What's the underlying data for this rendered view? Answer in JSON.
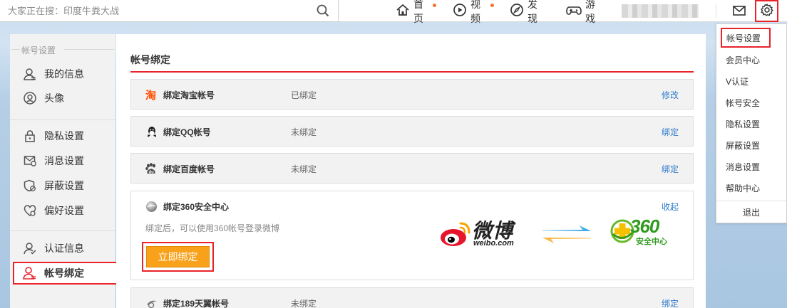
{
  "search": {
    "placeholder": "大家正在搜：印度牛粪大战"
  },
  "nav": {
    "home": "首页",
    "video": "视频",
    "discover": "发现",
    "game": "游戏"
  },
  "sidebar": {
    "heading": "帐号设置",
    "items": [
      {
        "label": "我的信息",
        "icon": "user-icon"
      },
      {
        "label": "头像",
        "icon": "avatar-icon"
      },
      {
        "label": "隐私设置",
        "icon": "lock-icon"
      },
      {
        "label": "消息设置",
        "icon": "message-icon"
      },
      {
        "label": "屏蔽设置",
        "icon": "shield-icon"
      },
      {
        "label": "偏好设置",
        "icon": "heart-icon"
      },
      {
        "label": "认证信息",
        "icon": "verify-icon"
      },
      {
        "label": "帐号绑定",
        "icon": "account-bind-icon"
      }
    ]
  },
  "main": {
    "title": "帐号绑定",
    "rows": [
      {
        "name": "绑定淘宝帐号",
        "status": "已绑定",
        "action": "修改",
        "icon": "taobao-icon"
      },
      {
        "name": "绑定QQ帐号",
        "status": "未绑定",
        "action": "绑定",
        "icon": "qq-icon"
      },
      {
        "name": "绑定百度帐号",
        "status": "未绑定",
        "action": "绑定",
        "icon": "baidu-icon"
      }
    ],
    "expanded": {
      "name": "绑定360安全中心",
      "action": "收起",
      "description": "绑定后，可以使用360帐号登录微博",
      "button": "立即绑定",
      "weibo_text": "微博",
      "weibo_domain": "weibo.com",
      "brand_360": "360",
      "brand_360_sub": "安全中心"
    },
    "last_row": {
      "name": "绑定189天翼帐号",
      "status": "未绑定",
      "action": "绑定"
    }
  },
  "dropdown": {
    "items": [
      "帐号设置",
      "会员中心",
      "V认证",
      "帐号安全",
      "隐私设置",
      "屏蔽设置",
      "消息设置",
      "帮助中心"
    ],
    "exit": "退出"
  },
  "colors": {
    "accent": "#e8232a",
    "link": "#2f7bcc",
    "button": "#f8a11b",
    "dot": "#f6722b"
  }
}
